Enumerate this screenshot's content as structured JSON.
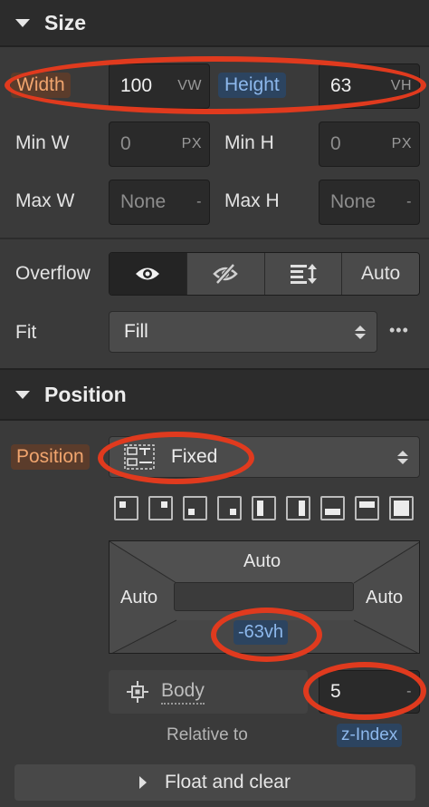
{
  "size": {
    "title": "Size",
    "width_label": "Width",
    "width_value": "100",
    "width_unit": "VW",
    "height_label": "Height",
    "height_value": "63",
    "height_unit": "VH",
    "min_w_label": "Min W",
    "min_w_value": "0",
    "min_w_unit": "PX",
    "min_h_label": "Min H",
    "min_h_value": "0",
    "min_h_unit": "PX",
    "max_w_label": "Max W",
    "max_w_value": "None",
    "max_w_unit": "-",
    "max_h_label": "Max H",
    "max_h_value": "None",
    "max_h_unit": "-",
    "overflow_label": "Overflow",
    "overflow_auto": "Auto",
    "fit_label": "Fit",
    "fit_value": "Fill",
    "more_label": "•••"
  },
  "position": {
    "title": "Position",
    "position_label": "Position",
    "position_value": "Fixed",
    "box_top": "Auto",
    "box_left": "Auto",
    "box_right": "Auto",
    "box_bottom": "-63vh",
    "relative_element": "Body",
    "relative_to_label": "Relative to",
    "zindex_value": "5",
    "zindex_unit": "-",
    "zindex_label": "z-Index"
  },
  "float": {
    "title": "Float and clear"
  },
  "colors": {
    "annotation_red": "#e03a1e",
    "highlight_orange": "#f1a56e",
    "highlight_blue": "#8db8ec"
  }
}
